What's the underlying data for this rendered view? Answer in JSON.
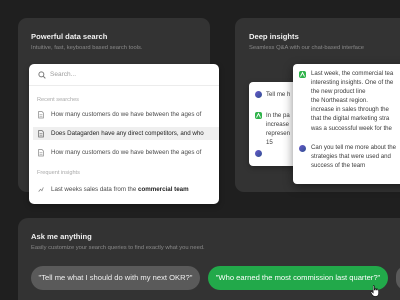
{
  "search_card": {
    "title": "Powerful data search",
    "subtitle": "Intuitive, fast, keyboard based search tools.",
    "search_placeholder": "Search...",
    "recent_label": "Recent searches",
    "recent_items": [
      "How many customers do we have between the ages of",
      "Does Datagarden have any direct competitors, and who",
      "How many customers do we have between the ages of"
    ],
    "insights_label": "Frequent insights",
    "insight_prefix": "Last weeks sales data from the ",
    "insight_bold": "commercial team"
  },
  "insights_card": {
    "title": "Deep insights",
    "subtitle": "Seamless Q&A with our chat-based interface",
    "back_panel": {
      "user_msg": "Tell me h",
      "bot_lines": [
        "In the pa",
        "increase",
        "represen",
        "15"
      ]
    },
    "front_panel": {
      "bot_lines": [
        "Last week, the commercial tea",
        "interesting insights. One of the",
        "the new product line",
        "the Northeast region.",
        "increase in sales through the",
        "that the digital marketing stra",
        "was a successful week for the"
      ],
      "user_lines": [
        "Can you tell me more about the",
        "strategies that were used and",
        "success of the team"
      ]
    }
  },
  "ask_card": {
    "title": "Ask me anything",
    "subtitle": "Easily customize your search queries to find exactly what you need.",
    "suggestions": [
      "\"Tell me what I should do with my next OKR?\"",
      "\"Who earned the most commission last quarter?\""
    ]
  },
  "colors": {
    "background": "#1f1f1f",
    "card": "#333333",
    "accent_green": "#22a94a",
    "pill_grey": "#5a5a5a"
  },
  "icons": {
    "search": "search-icon",
    "document": "document-icon",
    "bot_avatar": "bot-avatar-icon",
    "user_avatar": "user-avatar",
    "cursor": "hand-cursor-icon"
  }
}
